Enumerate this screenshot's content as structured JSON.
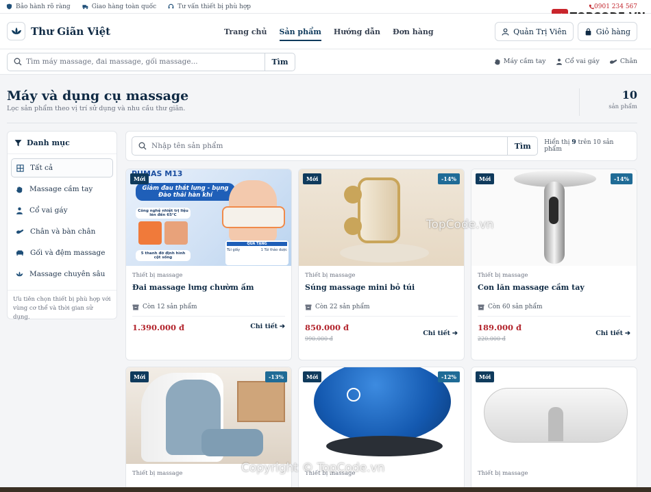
{
  "topbar": {
    "items": [
      "Bảo hành rõ ràng",
      "Giao hàng toàn quốc",
      "Tư vấn thiết bị phù hợp"
    ],
    "phone": "0901 234 567"
  },
  "brand_overlay": "TOPCODE.VN",
  "header": {
    "logo_text": "Thư Giãn Việt",
    "nav": [
      "Trang chủ",
      "Sản phẩm",
      "Hướng dẫn",
      "Đơn hàng"
    ],
    "active_nav": "Sản phẩm",
    "admin_label": "Quản Trị Viên",
    "cart_label": "Giỏ hàng"
  },
  "search": {
    "placeholder": "Tìm máy massage, đai massage, gối massage...",
    "button": "Tìm",
    "quick": [
      "Máy cầm tay",
      "Cổ vai gáy",
      "Chân"
    ]
  },
  "page": {
    "title": "Máy và dụng cụ massage",
    "subtitle": "Lọc sản phẩm theo vị trí sử dụng và nhu cầu thư giãn.",
    "count": "10",
    "count_label": "sản phẩm"
  },
  "sidebar": {
    "title": "Danh mục",
    "categories": [
      "Tất cả",
      "Massage cầm tay",
      "Cổ vai gáy",
      "Chân và bàn chân",
      "Gối và đệm massage",
      "Massage chuyên sâu"
    ],
    "note": "Ưu tiên chọn thiết bị phù hợp với vùng cơ thể và thời gian sử dụng."
  },
  "filter": {
    "placeholder": "Nhập tên sản phẩm",
    "button": "Tìm",
    "summary_prefix": "Hiển thị",
    "shown": "9",
    "summary_mid": "trên 10 sản phẩm"
  },
  "products": [
    {
      "badge_new": "Mới",
      "discount": "",
      "category": "Thiết bị massage",
      "name": "Đai massage lưng chườm ấm",
      "stock": "Còn 12 sản phẩm",
      "price": "1.390.000 đ",
      "old_price": "",
      "detail": "Chi tiết",
      "image_text": {
        "brand": "PUMAS M13",
        "headline": "Giảm đau thắt lưng - bụng",
        "sub": "Đào thải hàn khí",
        "feature1": "Công nghệ nhiệt trị liệu lên đến 65°C",
        "feature2": "5 thanh đỡ định hình cột sống",
        "tag": "QUÀ TẶNG",
        "tag2": "Túi giấy",
        "tag3": "1 Túi thảo dược"
      }
    },
    {
      "badge_new": "Mới",
      "discount": "-14%",
      "category": "Thiết bị massage",
      "name": "Súng massage mini bỏ túi",
      "stock": "Còn 22 sản phẩm",
      "price": "850.000 đ",
      "old_price": "990.000 đ",
      "detail": "Chi tiết"
    },
    {
      "badge_new": "Mới",
      "discount": "-14%",
      "category": "Thiết bị massage",
      "name": "Con lăn massage cầm tay",
      "stock": "Còn 60 sản phẩm",
      "price": "189.000 đ",
      "old_price": "220.000 đ",
      "detail": "Chi tiết"
    },
    {
      "badge_new": "Mới",
      "discount": "-13%",
      "category": "Thiết bị massage",
      "name": "",
      "stock": "",
      "price": "",
      "old_price": "",
      "detail": ""
    },
    {
      "badge_new": "Mới",
      "discount": "-12%",
      "category": "Thiết bị massage",
      "name": "",
      "stock": "",
      "price": "",
      "old_price": "",
      "detail": ""
    },
    {
      "badge_new": "Mới",
      "discount": "",
      "category": "Thiết bị massage",
      "name": "",
      "stock": "",
      "price": "",
      "old_price": "",
      "detail": ""
    }
  ],
  "watermarks": [
    "TopCode.vn",
    "Copyright © TopCode.vn"
  ]
}
